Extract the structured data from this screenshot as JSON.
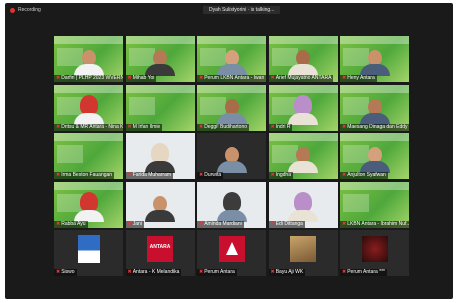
{
  "recording_label": "Recording",
  "speaker_banner": "Dyah Sulistyorini · is talking...",
  "participants": [
    {
      "name": "Darfin | PLHP 2023 WVERNA",
      "tile": "green",
      "person": "man"
    },
    {
      "name": "Mihab Yoi",
      "tile": "green",
      "person": "man"
    },
    {
      "name": "Perum LKBN Antara - Iwan Su...",
      "tile": "green",
      "person": "man"
    },
    {
      "name": "Arief Mujayatno ANTARA",
      "tile": "green",
      "person": "man"
    },
    {
      "name": "Heny Antara",
      "tile": "green",
      "person": "man"
    },
    {
      "name": "Dritsu & MR Antara - Nina Kuris...",
      "tile": "green",
      "person": "hijab-woman"
    },
    {
      "name": "M Irfan Ilmie",
      "tile": "green",
      "person": "none"
    },
    {
      "name": "Deggi! Budihartono",
      "tile": "green",
      "person": "man"
    },
    {
      "name": "Indri R",
      "tile": "green",
      "person": "hijab-woman"
    },
    {
      "name": "Maesang Dinaga dan Eddy Pr...",
      "tile": "green",
      "person": "man"
    },
    {
      "name": "Irma Beston Fauangan",
      "tile": "green",
      "person": "none"
    },
    {
      "name": "Farida Muharram",
      "tile": "light",
      "person": "hijab-woman"
    },
    {
      "name": "Durwita",
      "tile": "dark",
      "person": "man"
    },
    {
      "name": "Ingdha",
      "tile": "green",
      "person": "man"
    },
    {
      "name": "Anjulton Syafwan",
      "tile": "green",
      "person": "man"
    },
    {
      "name": "Rabba Ayu",
      "tile": "green",
      "person": "hijab-woman"
    },
    {
      "name": "Jani",
      "tile": "light",
      "person": "man"
    },
    {
      "name": "Aminda Mardiani",
      "tile": "light",
      "person": "hijab-woman"
    },
    {
      "name": "Edi Dittanga",
      "tile": "light",
      "person": "hijab-woman"
    },
    {
      "name": "LKBN Antara - Ibrahim Nuf...",
      "tile": "green",
      "person": "none"
    },
    {
      "name": "Siswo",
      "tile": "dark",
      "person": "avatar"
    },
    {
      "name": "Antara - K Melandika",
      "tile": "dark",
      "person": "antara"
    },
    {
      "name": "Perum Antara",
      "tile": "dark",
      "person": "triangle"
    },
    {
      "name": "Bayu Aji WK",
      "tile": "dark",
      "person": "photo"
    },
    {
      "name": "Perum Antara ***",
      "tile": "dark",
      "person": "dark-photo"
    }
  ],
  "logo_text": "ANTARA",
  "colors": {
    "window_bg": "#1a1a1a",
    "tile_green": "#7cc142",
    "tile_dark": "#2b2b2b",
    "rec_red": "#e0342b",
    "mic_muted": "#e53935",
    "brand_red": "#c8102e"
  }
}
